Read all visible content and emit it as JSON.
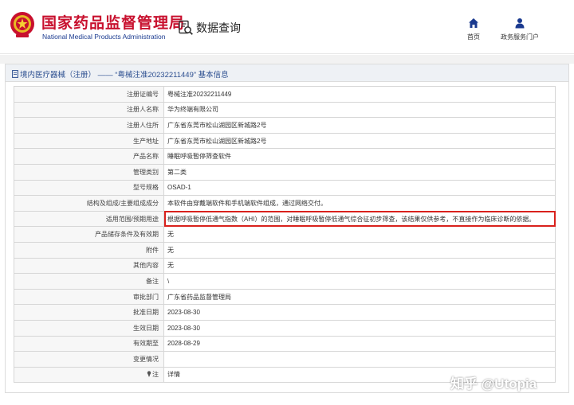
{
  "header": {
    "org_name_cn": "国家药品监督管理局",
    "org_name_en": "National Medical Products Administration",
    "query_label": "数据查询",
    "nav": [
      {
        "label": "首页",
        "icon": "home-icon"
      },
      {
        "label": "政务服务门户",
        "icon": "user-icon"
      }
    ]
  },
  "panel": {
    "title": "境内医疗器械（注册） —— “粤械注准20232211449” 基本信息"
  },
  "record": [
    {
      "key": "注册证编号",
      "value": "粤械注准20232211449"
    },
    {
      "key": "注册人名称",
      "value": "华为终端有限公司"
    },
    {
      "key": "注册人住所",
      "value": "广东省东莞市松山湖园区新城路2号"
    },
    {
      "key": "生产地址",
      "value": "广东省东莞市松山湖园区新城路2号"
    },
    {
      "key": "产品名称",
      "value": "睡眠呼吸暂停筛查软件"
    },
    {
      "key": "管理类别",
      "value": "第二类"
    },
    {
      "key": "型号规格",
      "value": "OSAD-1"
    },
    {
      "key": "结构及组成/主要组成成分",
      "value": "本软件由穿戴端软件和手机端软件组成，通过网络交付。"
    },
    {
      "key": "适用范围/预期用途",
      "value": "根据呼吸暂停低通气指数（AHI）的范围，对睡眠呼吸暂停低通气综合征初步筛查，该结果仅供参考，不直接作为临床诊断的依据。"
    },
    {
      "key": "产品储存条件及有效期",
      "value": "无"
    },
    {
      "key": "附件",
      "value": "无"
    },
    {
      "key": "其他内容",
      "value": "无"
    },
    {
      "key": "备注",
      "value": "\\"
    },
    {
      "key": "审批部门",
      "value": "广东省药品监督管理局"
    },
    {
      "key": "批准日期",
      "value": "2023-08-30"
    },
    {
      "key": "生效日期",
      "value": "2023-08-30"
    },
    {
      "key": "有效期至",
      "value": "2028-08-29"
    },
    {
      "key": "变更情况",
      "value": ""
    },
    {
      "key": "注",
      "value": "详情"
    }
  ],
  "watermark": "知乎 @Utopia",
  "colors": {
    "brand_red": "#c8102e",
    "brand_blue": "#1a3a8f",
    "highlight_border": "#d9211c",
    "link": "#2a5db0"
  }
}
